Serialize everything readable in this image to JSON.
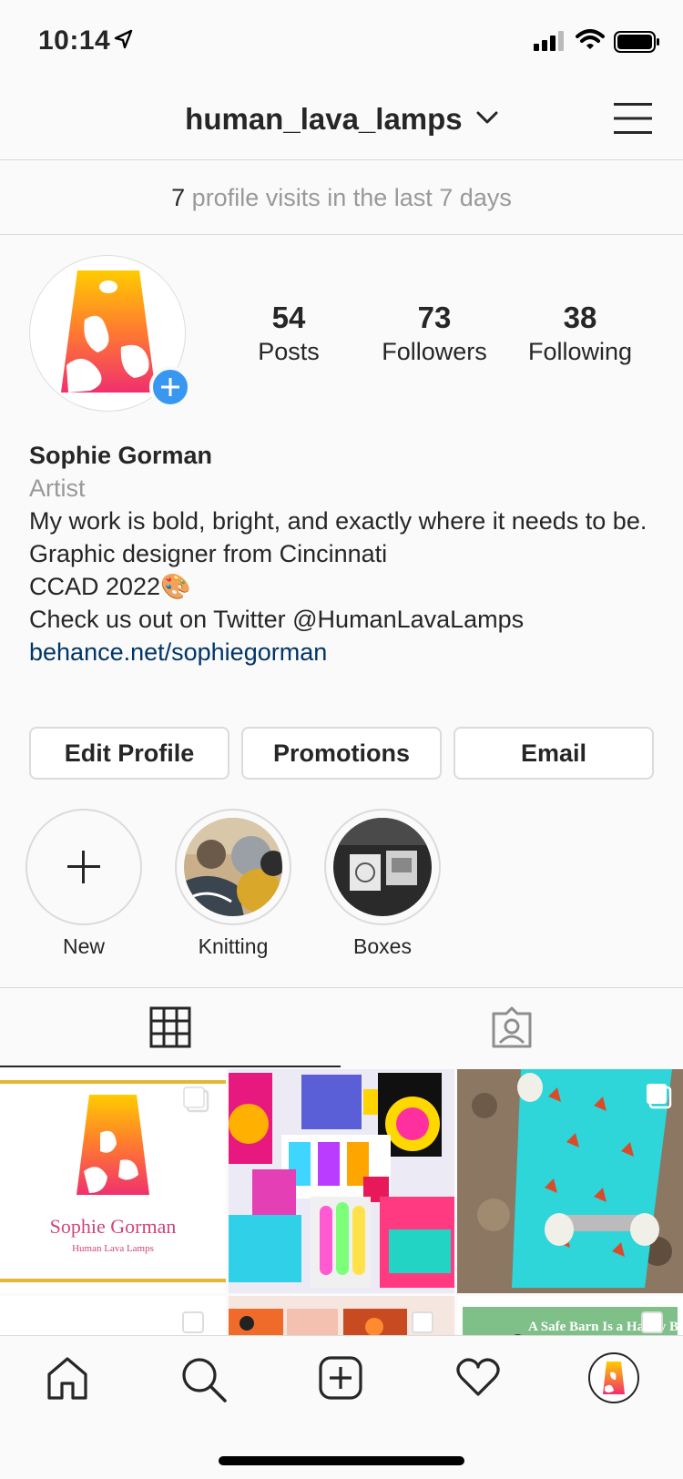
{
  "status_bar": {
    "time": "10:14"
  },
  "header": {
    "username": "human_lava_lamps"
  },
  "visits": {
    "count": "7",
    "text": " profile visits in the last 7 days"
  },
  "stats": [
    {
      "value": "54",
      "label": "Posts"
    },
    {
      "value": "73",
      "label": "Followers"
    },
    {
      "value": "38",
      "label": "Following"
    }
  ],
  "bio": {
    "name": "Sophie Gorman",
    "category": "Artist",
    "line1": "My work is bold, bright, and exactly where it needs to be.",
    "line2": "Graphic designer from Cincinnati",
    "line3": "CCAD 2022🎨",
    "line4": "Check us out on Twitter @HumanLavaLamps",
    "link": "behance.net/sophiegorman"
  },
  "buttons": {
    "edit_profile": "Edit Profile",
    "promotions": "Promotions",
    "email": "Email"
  },
  "highlights": [
    {
      "label": "New"
    },
    {
      "label": "Knitting"
    },
    {
      "label": "Boxes"
    }
  ],
  "grid": {
    "post1_title": "Sophie Gorman",
    "post1_subtitle": "Human Lava Lamps",
    "post6_caption": "A Safe Barn Is a Happy Barn"
  },
  "icons": {
    "location": "location-arrow-icon",
    "signal": "signal-icon",
    "wifi": "wifi-icon",
    "battery": "battery-icon",
    "menu": "hamburger-menu-icon",
    "grid": "grid-icon",
    "tagged": "tagged-icon",
    "home": "home-icon",
    "search": "search-icon",
    "add": "add-post-icon",
    "activity": "heart-icon"
  },
  "colors": {
    "accent": "#3897f0",
    "link": "#003569",
    "muted": "#999999"
  }
}
